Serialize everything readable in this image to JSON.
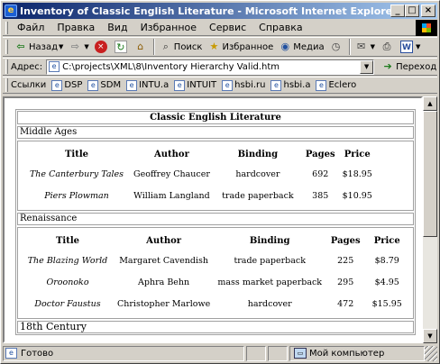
{
  "window": {
    "title": "Inventory of Classic English Literature - Microsoft Internet Explorer - [Автоно",
    "buttons": {
      "minimize": "_",
      "maximize": "□",
      "close": "×"
    }
  },
  "menu": {
    "items": [
      "Файл",
      "Правка",
      "Вид",
      "Избранное",
      "Сервис",
      "Справка"
    ]
  },
  "toolbar": {
    "back_label": "Назад",
    "search_label": "Поиск",
    "favorites_label": "Избранное",
    "media_label": "Медиа"
  },
  "address": {
    "label": "Адрес:",
    "url": "C:\\projects\\XML\\8\\Inventory Hierarchy Valid.htm",
    "go_label": "Переход"
  },
  "links": {
    "label": "Ссылки",
    "items": [
      "DSP",
      "SDM",
      "INTU.a",
      "INTUIT",
      "hsbi.ru",
      "hsbi.a",
      "Eclero"
    ]
  },
  "document": {
    "title": "Classic English Literature",
    "columns": [
      "Title",
      "Author",
      "Binding",
      "Pages",
      "Price"
    ],
    "eras": [
      {
        "name": "Middle Ages",
        "books": [
          [
            "The Canterbury Tales",
            "Geoffrey Chaucer",
            "hardcover",
            "692",
            "$18.95"
          ],
          [
            "Piers Plowman",
            "William Langland",
            "trade paperback",
            "385",
            "$10.95"
          ]
        ]
      },
      {
        "name": "Renaissance",
        "books": [
          [
            "The Blazing World",
            "Margaret Cavendish",
            "trade paperback",
            "225",
            "$8.79"
          ],
          [
            "Oroonoko",
            "Aphra Behn",
            "mass market paperback",
            "295",
            "$4.95"
          ],
          [
            "Doctor Faustus",
            "Christopher Marlowe",
            "hardcover",
            "472",
            "$15.95"
          ]
        ]
      }
    ],
    "next_era": "18th Century"
  },
  "status": {
    "text": "Готово",
    "zone": "Мой компьютер"
  }
}
